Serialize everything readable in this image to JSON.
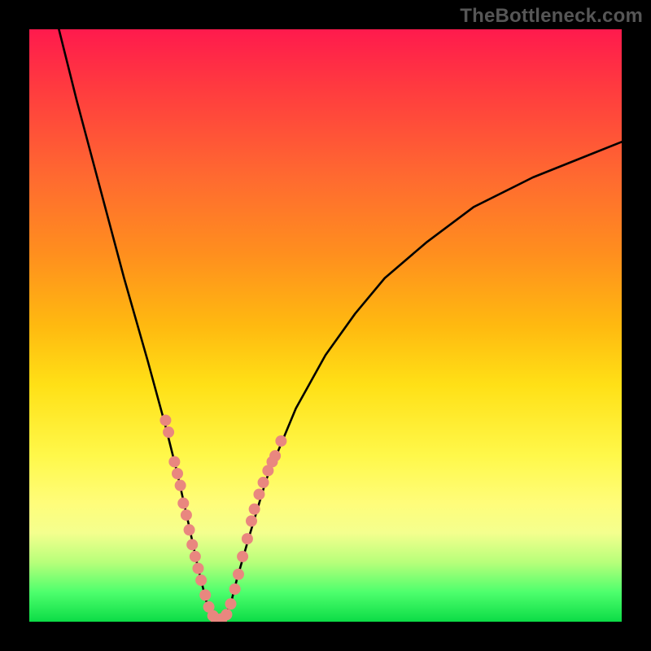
{
  "watermark": "TheBottleneck.com",
  "colors": {
    "frame": "#000000",
    "curve": "#000000",
    "dots": "#e9877f",
    "gradient_top": "#ff1a4d",
    "gradient_bottom": "#0cdc46"
  },
  "chart_data": {
    "type": "line",
    "title": "",
    "xlabel": "",
    "ylabel": "",
    "xlim": [
      0,
      100
    ],
    "ylim": [
      0,
      100
    ],
    "series": [
      {
        "name": "bottleneck-curve",
        "x": [
          5,
          8,
          12,
          16,
          20,
          23,
          25,
          27,
          28.5,
          30,
          31,
          32,
          33,
          34,
          35,
          37,
          40,
          45,
          50,
          55,
          60,
          67,
          75,
          85,
          95,
          100
        ],
        "y": [
          100,
          88,
          73,
          58,
          44,
          33,
          25,
          16,
          9,
          3,
          0.5,
          0,
          1,
          3,
          7,
          14,
          24,
          36,
          45,
          52,
          58,
          64,
          70,
          75,
          79,
          81
        ]
      }
    ],
    "scatter_clusters": [
      {
        "name": "left-branch-dots",
        "points": [
          [
            23,
            34
          ],
          [
            23.5,
            32
          ],
          [
            24.5,
            27
          ],
          [
            25,
            25
          ],
          [
            25.5,
            23
          ],
          [
            26,
            20
          ],
          [
            26.5,
            18
          ],
          [
            27,
            15.5
          ],
          [
            27.5,
            13
          ],
          [
            28,
            11
          ],
          [
            28.5,
            9
          ],
          [
            29,
            7
          ],
          [
            29.7,
            4.5
          ],
          [
            30.3,
            2.5
          ],
          [
            31,
            1
          ],
          [
            31.5,
            0.5
          ],
          [
            32,
            0.3
          ],
          [
            32.5,
            0.5
          ],
          [
            33.3,
            1.2
          ]
        ]
      },
      {
        "name": "right-branch-dots",
        "points": [
          [
            34,
            3
          ],
          [
            34.7,
            5.5
          ],
          [
            35.3,
            8
          ],
          [
            36,
            11
          ],
          [
            36.8,
            14
          ],
          [
            37.5,
            17
          ],
          [
            38,
            19
          ],
          [
            38.8,
            21.5
          ],
          [
            39.5,
            23.5
          ],
          [
            40.3,
            25.5
          ],
          [
            41,
            27
          ],
          [
            41.5,
            28
          ],
          [
            42.5,
            30.5
          ]
        ]
      }
    ]
  }
}
